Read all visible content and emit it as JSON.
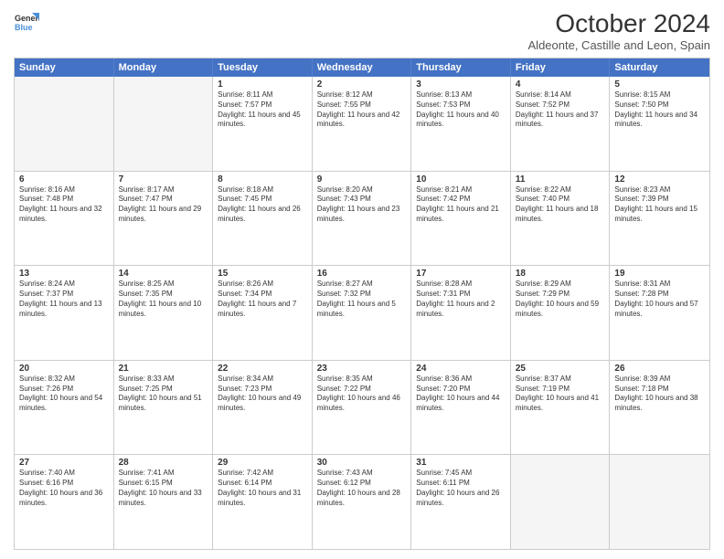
{
  "logo": {
    "line1": "General",
    "line2": "Blue"
  },
  "title": "October 2024",
  "subtitle": "Aldeonte, Castille and Leon, Spain",
  "header_days": [
    "Sunday",
    "Monday",
    "Tuesday",
    "Wednesday",
    "Thursday",
    "Friday",
    "Saturday"
  ],
  "weeks": [
    [
      {
        "day": "",
        "sunrise": "",
        "sunset": "",
        "daylight": ""
      },
      {
        "day": "",
        "sunrise": "",
        "sunset": "",
        "daylight": ""
      },
      {
        "day": "1",
        "sunrise": "Sunrise: 8:11 AM",
        "sunset": "Sunset: 7:57 PM",
        "daylight": "Daylight: 11 hours and 45 minutes."
      },
      {
        "day": "2",
        "sunrise": "Sunrise: 8:12 AM",
        "sunset": "Sunset: 7:55 PM",
        "daylight": "Daylight: 11 hours and 42 minutes."
      },
      {
        "day": "3",
        "sunrise": "Sunrise: 8:13 AM",
        "sunset": "Sunset: 7:53 PM",
        "daylight": "Daylight: 11 hours and 40 minutes."
      },
      {
        "day": "4",
        "sunrise": "Sunrise: 8:14 AM",
        "sunset": "Sunset: 7:52 PM",
        "daylight": "Daylight: 11 hours and 37 minutes."
      },
      {
        "day": "5",
        "sunrise": "Sunrise: 8:15 AM",
        "sunset": "Sunset: 7:50 PM",
        "daylight": "Daylight: 11 hours and 34 minutes."
      }
    ],
    [
      {
        "day": "6",
        "sunrise": "Sunrise: 8:16 AM",
        "sunset": "Sunset: 7:48 PM",
        "daylight": "Daylight: 11 hours and 32 minutes."
      },
      {
        "day": "7",
        "sunrise": "Sunrise: 8:17 AM",
        "sunset": "Sunset: 7:47 PM",
        "daylight": "Daylight: 11 hours and 29 minutes."
      },
      {
        "day": "8",
        "sunrise": "Sunrise: 8:18 AM",
        "sunset": "Sunset: 7:45 PM",
        "daylight": "Daylight: 11 hours and 26 minutes."
      },
      {
        "day": "9",
        "sunrise": "Sunrise: 8:20 AM",
        "sunset": "Sunset: 7:43 PM",
        "daylight": "Daylight: 11 hours and 23 minutes."
      },
      {
        "day": "10",
        "sunrise": "Sunrise: 8:21 AM",
        "sunset": "Sunset: 7:42 PM",
        "daylight": "Daylight: 11 hours and 21 minutes."
      },
      {
        "day": "11",
        "sunrise": "Sunrise: 8:22 AM",
        "sunset": "Sunset: 7:40 PM",
        "daylight": "Daylight: 11 hours and 18 minutes."
      },
      {
        "day": "12",
        "sunrise": "Sunrise: 8:23 AM",
        "sunset": "Sunset: 7:39 PM",
        "daylight": "Daylight: 11 hours and 15 minutes."
      }
    ],
    [
      {
        "day": "13",
        "sunrise": "Sunrise: 8:24 AM",
        "sunset": "Sunset: 7:37 PM",
        "daylight": "Daylight: 11 hours and 13 minutes."
      },
      {
        "day": "14",
        "sunrise": "Sunrise: 8:25 AM",
        "sunset": "Sunset: 7:35 PM",
        "daylight": "Daylight: 11 hours and 10 minutes."
      },
      {
        "day": "15",
        "sunrise": "Sunrise: 8:26 AM",
        "sunset": "Sunset: 7:34 PM",
        "daylight": "Daylight: 11 hours and 7 minutes."
      },
      {
        "day": "16",
        "sunrise": "Sunrise: 8:27 AM",
        "sunset": "Sunset: 7:32 PM",
        "daylight": "Daylight: 11 hours and 5 minutes."
      },
      {
        "day": "17",
        "sunrise": "Sunrise: 8:28 AM",
        "sunset": "Sunset: 7:31 PM",
        "daylight": "Daylight: 11 hours and 2 minutes."
      },
      {
        "day": "18",
        "sunrise": "Sunrise: 8:29 AM",
        "sunset": "Sunset: 7:29 PM",
        "daylight": "Daylight: 10 hours and 59 minutes."
      },
      {
        "day": "19",
        "sunrise": "Sunrise: 8:31 AM",
        "sunset": "Sunset: 7:28 PM",
        "daylight": "Daylight: 10 hours and 57 minutes."
      }
    ],
    [
      {
        "day": "20",
        "sunrise": "Sunrise: 8:32 AM",
        "sunset": "Sunset: 7:26 PM",
        "daylight": "Daylight: 10 hours and 54 minutes."
      },
      {
        "day": "21",
        "sunrise": "Sunrise: 8:33 AM",
        "sunset": "Sunset: 7:25 PM",
        "daylight": "Daylight: 10 hours and 51 minutes."
      },
      {
        "day": "22",
        "sunrise": "Sunrise: 8:34 AM",
        "sunset": "Sunset: 7:23 PM",
        "daylight": "Daylight: 10 hours and 49 minutes."
      },
      {
        "day": "23",
        "sunrise": "Sunrise: 8:35 AM",
        "sunset": "Sunset: 7:22 PM",
        "daylight": "Daylight: 10 hours and 46 minutes."
      },
      {
        "day": "24",
        "sunrise": "Sunrise: 8:36 AM",
        "sunset": "Sunset: 7:20 PM",
        "daylight": "Daylight: 10 hours and 44 minutes."
      },
      {
        "day": "25",
        "sunrise": "Sunrise: 8:37 AM",
        "sunset": "Sunset: 7:19 PM",
        "daylight": "Daylight: 10 hours and 41 minutes."
      },
      {
        "day": "26",
        "sunrise": "Sunrise: 8:39 AM",
        "sunset": "Sunset: 7:18 PM",
        "daylight": "Daylight: 10 hours and 38 minutes."
      }
    ],
    [
      {
        "day": "27",
        "sunrise": "Sunrise: 7:40 AM",
        "sunset": "Sunset: 6:16 PM",
        "daylight": "Daylight: 10 hours and 36 minutes."
      },
      {
        "day": "28",
        "sunrise": "Sunrise: 7:41 AM",
        "sunset": "Sunset: 6:15 PM",
        "daylight": "Daylight: 10 hours and 33 minutes."
      },
      {
        "day": "29",
        "sunrise": "Sunrise: 7:42 AM",
        "sunset": "Sunset: 6:14 PM",
        "daylight": "Daylight: 10 hours and 31 minutes."
      },
      {
        "day": "30",
        "sunrise": "Sunrise: 7:43 AM",
        "sunset": "Sunset: 6:12 PM",
        "daylight": "Daylight: 10 hours and 28 minutes."
      },
      {
        "day": "31",
        "sunrise": "Sunrise: 7:45 AM",
        "sunset": "Sunset: 6:11 PM",
        "daylight": "Daylight: 10 hours and 26 minutes."
      },
      {
        "day": "",
        "sunrise": "",
        "sunset": "",
        "daylight": ""
      },
      {
        "day": "",
        "sunrise": "",
        "sunset": "",
        "daylight": ""
      }
    ]
  ]
}
